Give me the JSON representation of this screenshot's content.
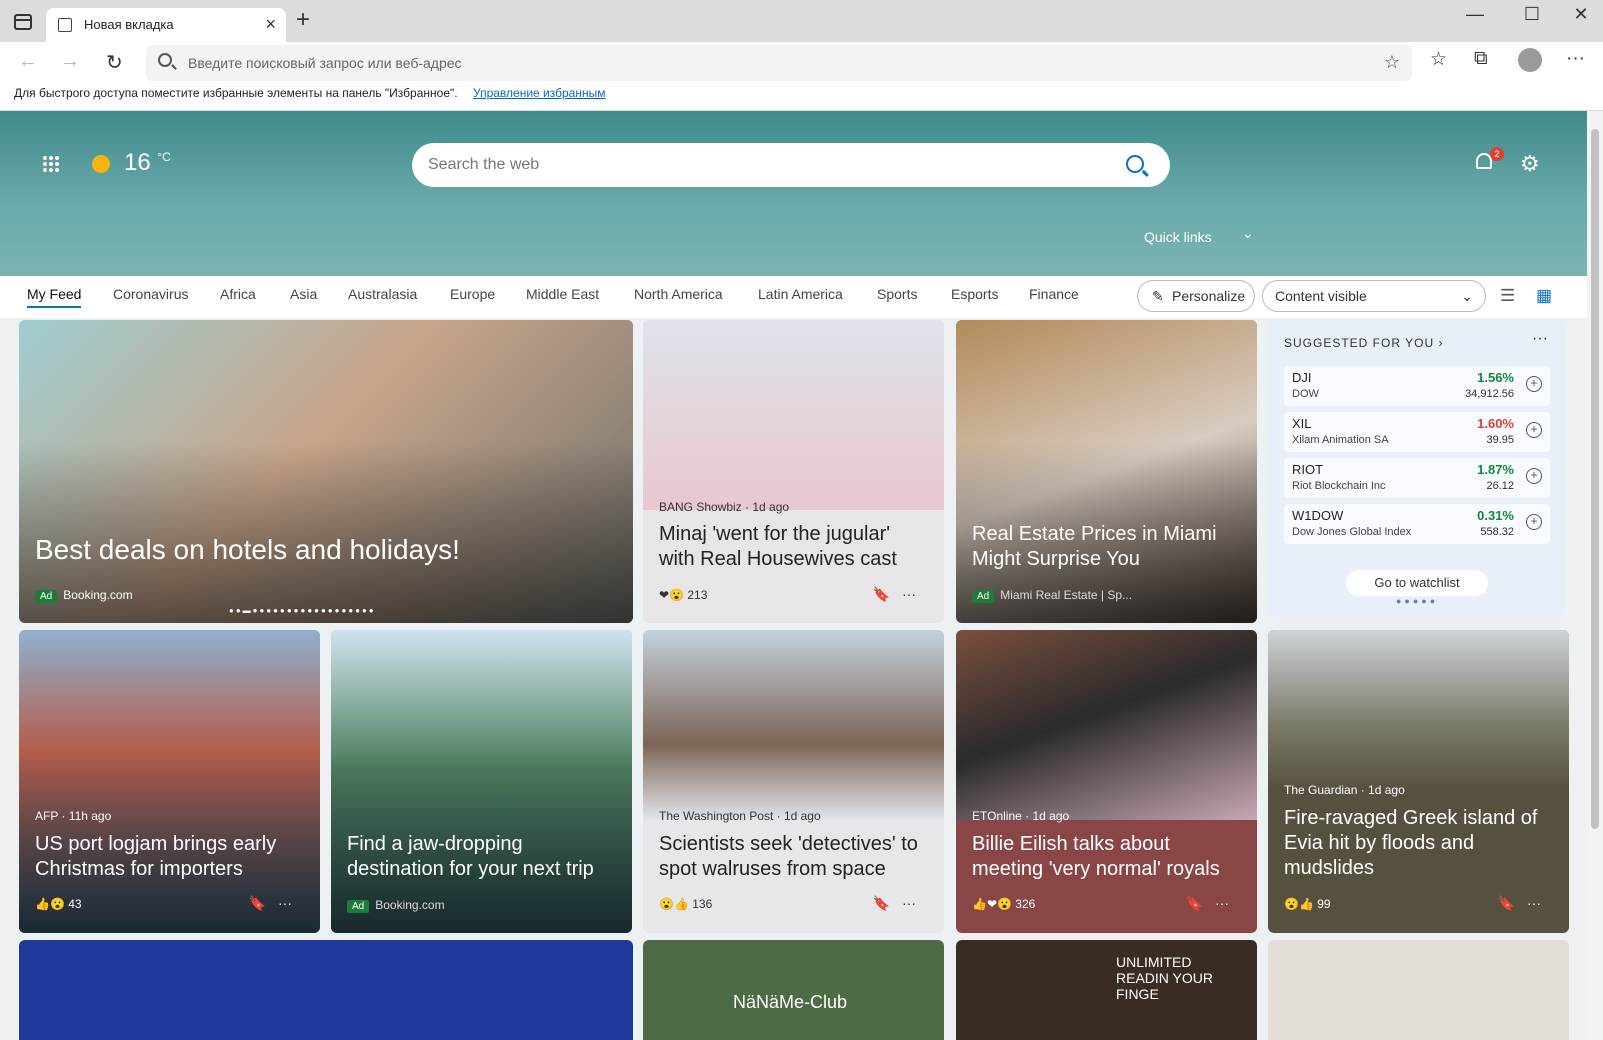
{
  "browser": {
    "tab_title": "Новая вкладка",
    "address_placeholder": "Введите поисковый запрос или веб-адрес",
    "favbar_text": "Для быстрого доступа поместите избранные элементы на панель \"Избранное\".",
    "favbar_link": "Управление избранным"
  },
  "header": {
    "temperature": "16",
    "temp_unit": "°C",
    "search_placeholder": "Search the web",
    "notification_count": "2",
    "quick_links": "Quick links"
  },
  "nav": {
    "tabs": [
      "My Feed",
      "Coronavirus",
      "Africa",
      "Asia",
      "Australasia",
      "Europe",
      "Middle East",
      "North America",
      "Latin America",
      "Sports",
      "Esports",
      "Finance"
    ],
    "personalize": "Personalize",
    "content_visible": "Content visible"
  },
  "cards": [
    {
      "title": "Best deals on hotels and holidays!",
      "badge": "Ad",
      "source": "Booking.com"
    },
    {
      "source": "BANG Showbiz · 1d ago",
      "title": "Minaj 'went for the jugular' with Real Housewives cast",
      "reactions": "213"
    },
    {
      "title": "Real Estate Prices in Miami Might Surprise You",
      "badge": "Ad",
      "source": "Miami Real Estate | Sp..."
    },
    {
      "source": "AFP · 11h ago",
      "title": "US port logjam brings early Christmas for importers",
      "reactions": "43"
    },
    {
      "title": "Find a jaw-dropping destination for your next trip",
      "badge": "Ad",
      "source": "Booking.com"
    },
    {
      "source": "The Washington Post · 1d ago",
      "title": "Scientists seek 'detectives' to spot walruses from space",
      "reactions": "136"
    },
    {
      "source": "ETOnline · 1d ago",
      "title": "Billie Eilish talks about meeting 'very normal' royals",
      "reactions": "326"
    },
    {
      "source": "The Guardian · 1d ago",
      "title": "Fire-ravaged Greek island of Evia hit by floods and mudslides",
      "reactions": "99"
    }
  ],
  "watchlist": {
    "heading": "SUGGESTED FOR YOU",
    "stocks": [
      {
        "symbol": "DJI",
        "name": "DOW",
        "change": "1.56%",
        "price": "34,912.56",
        "color": "#138a36"
      },
      {
        "symbol": "XIL",
        "name": "Xilam Animation SA",
        "change": "1.60%",
        "price": "39.95",
        "color": "#d9432f"
      },
      {
        "symbol": "RIOT",
        "name": "Riot Blockchain Inc",
        "change": "1.87%",
        "price": "26.12",
        "color": "#138a36"
      },
      {
        "symbol": "W1DOW",
        "name": "Dow Jones Global Index",
        "change": "0.31%",
        "price": "558.32",
        "color": "#138a36"
      }
    ],
    "button": "Go to watchlist"
  },
  "bottom_texts": {
    "promo": "UNLIMITED READIN YOUR FINGE",
    "watermark": "NäNäMe-Club"
  }
}
